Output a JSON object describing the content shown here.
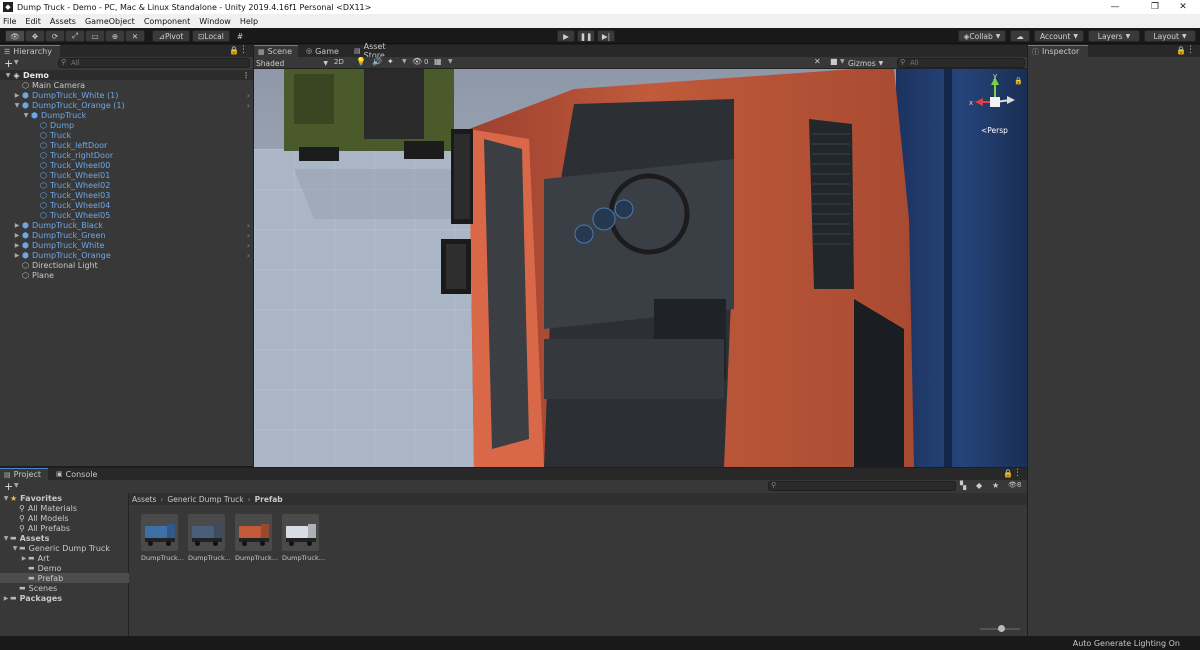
{
  "window": {
    "title": "Dump Truck - Demo - PC, Mac & Linux Standalone - Unity 2019.4.16f1 Personal <DX11>",
    "minimize": "—",
    "maximize": "❐",
    "close": "✕"
  },
  "menu": [
    "File",
    "Edit",
    "Assets",
    "GameObject",
    "Component",
    "Window",
    "Help"
  ],
  "toolbar": {
    "pivot": "Pivot",
    "local": "Local",
    "collab": "Collab",
    "account": "Account",
    "layers": "Layers",
    "layout": "Layout"
  },
  "hierarchy": {
    "tab": "Hierarchy",
    "search_placeholder": "All",
    "items": [
      {
        "label": "Demo",
        "level": 0,
        "kind": "scene",
        "expanded": true
      },
      {
        "label": "Main Camera",
        "level": 1,
        "kind": "go"
      },
      {
        "label": "DumpTruck_White (1)",
        "level": 1,
        "kind": "prefab",
        "collapsed": true
      },
      {
        "label": "DumpTruck_Orange (1)",
        "level": 1,
        "kind": "prefab",
        "expanded": true
      },
      {
        "label": "DumpTruck",
        "level": 2,
        "kind": "prefab",
        "expanded": true
      },
      {
        "label": "Dump",
        "level": 3,
        "kind": "part"
      },
      {
        "label": "Truck",
        "level": 3,
        "kind": "part"
      },
      {
        "label": "Truck_leftDoor",
        "level": 3,
        "kind": "part"
      },
      {
        "label": "Truck_rightDoor",
        "level": 3,
        "kind": "part"
      },
      {
        "label": "Truck_Wheel00",
        "level": 3,
        "kind": "part"
      },
      {
        "label": "Truck_Wheel01",
        "level": 3,
        "kind": "part"
      },
      {
        "label": "Truck_Wheel02",
        "level": 3,
        "kind": "part"
      },
      {
        "label": "Truck_Wheel03",
        "level": 3,
        "kind": "part"
      },
      {
        "label": "Truck_Wheel04",
        "level": 3,
        "kind": "part"
      },
      {
        "label": "Truck_Wheel05",
        "level": 3,
        "kind": "part"
      },
      {
        "label": "DumpTruck_Black",
        "level": 1,
        "kind": "prefab",
        "collapsed": true
      },
      {
        "label": "DumpTruck_Green",
        "level": 1,
        "kind": "prefab",
        "collapsed": true
      },
      {
        "label": "DumpTruck_White",
        "level": 1,
        "kind": "prefab",
        "collapsed": true
      },
      {
        "label": "DumpTruck_Orange",
        "level": 1,
        "kind": "prefab",
        "collapsed": true
      },
      {
        "label": "Directional Light",
        "level": 1,
        "kind": "go"
      },
      {
        "label": "Plane",
        "level": 1,
        "kind": "go"
      }
    ]
  },
  "scene": {
    "tabs": [
      "Scene",
      "Game",
      "Asset Store"
    ],
    "shading": "Shaded",
    "mode2d": "2D",
    "hidden_count": "0",
    "gizmos": "Gizmos",
    "search_placeholder": "All",
    "persp": "<Persp",
    "axis_y": "y",
    "axis_x": "x"
  },
  "inspector": {
    "tab": "Inspector"
  },
  "project": {
    "tabs": [
      "Project",
      "Console"
    ],
    "tree": [
      {
        "label": "Favorites",
        "level": 0,
        "bold": true,
        "icon": "star"
      },
      {
        "label": "All Materials",
        "level": 1,
        "icon": "search"
      },
      {
        "label": "All Models",
        "level": 1,
        "icon": "search"
      },
      {
        "label": "All Prefabs",
        "level": 1,
        "icon": "search"
      },
      {
        "label": "Assets",
        "level": 0,
        "bold": true,
        "icon": "folder"
      },
      {
        "label": "Generic Dump Truck",
        "level": 1,
        "icon": "folder"
      },
      {
        "label": "Art",
        "level": 2,
        "icon": "folder"
      },
      {
        "label": "Demo",
        "level": 2,
        "icon": "folder"
      },
      {
        "label": "Prefab",
        "level": 2,
        "icon": "folder",
        "selected": true
      },
      {
        "label": "Scenes",
        "level": 1,
        "icon": "folder"
      },
      {
        "label": "Packages",
        "level": 0,
        "bold": true,
        "icon": "folder"
      }
    ],
    "breadcrumb": [
      "Assets",
      "Generic Dump Truck",
      "Prefab"
    ],
    "hidden_count": "8",
    "assets": [
      {
        "label": "DumpTruck...",
        "color": "#3d6fa8"
      },
      {
        "label": "DumpTruck...",
        "color": "#4a5e7a"
      },
      {
        "label": "DumpTruck...",
        "color": "#c05a3a"
      },
      {
        "label": "DumpTruck...",
        "color": "#d8dde5"
      }
    ]
  },
  "status": {
    "text": "Auto Generate Lighting On"
  },
  "colors": {
    "accent": "#4a82c9",
    "prefab_blue": "#6ea7e8",
    "truck_orange": "#c05a3a"
  }
}
